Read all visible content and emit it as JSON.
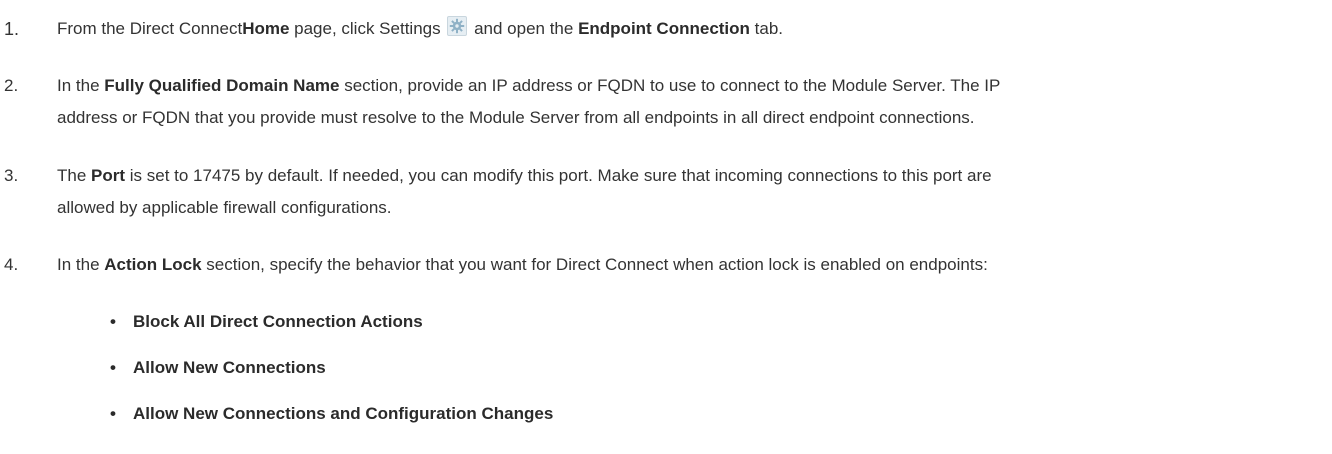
{
  "steps": [
    {
      "number": "1.",
      "t1": "From the Direct Connect",
      "b1": "Home",
      "t2": " page, click Settings ",
      "icon": "gear-icon",
      "t3": " and open the ",
      "b2": "Endpoint Connection",
      "t4": " tab."
    },
    {
      "number": "2.",
      "t1": "In the ",
      "b1": "Fully Qualified Domain Name",
      "t2": " section, provide an IP address or FQDN to use to connect to the Module Server. The IP",
      "t3": "address or FQDN that you provide must resolve to the Module Server from all endpoints in all direct endpoint connections."
    },
    {
      "number": "3.",
      "t1": "The ",
      "b1": "Port",
      "t2": " is set to 17475 by default. If needed, you can modify this port. Make sure that incoming connections to this port are",
      "t3": "allowed by applicable firewall configurations."
    },
    {
      "number": "4.",
      "t1": "In the ",
      "b1": "Action Lock",
      "t2": " section, specify the behavior that you want for Direct Connect when action lock is enabled on endpoints:"
    }
  ],
  "options": [
    {
      "bullet": "•",
      "label": "Block All Direct Connection Actions"
    },
    {
      "bullet": "•",
      "label": "Allow New Connections"
    },
    {
      "bullet": "•",
      "label": "Allow New Connections and Configuration Changes"
    }
  ],
  "colors": {
    "text": "#333333",
    "icon_bg": "#e6eef3",
    "icon_gear": "#8fb1c6"
  }
}
